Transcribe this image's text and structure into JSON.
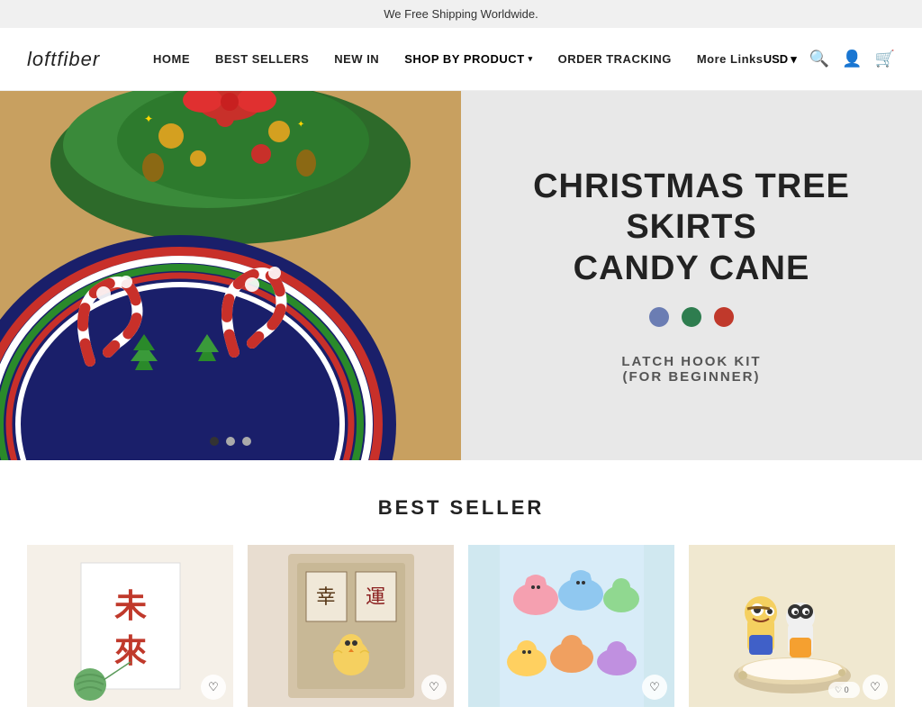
{
  "announcement": {
    "text": "We Free Shipping Worldwide."
  },
  "header": {
    "logo": "loftfiber",
    "nav": [
      {
        "label": "HOME",
        "has_dropdown": false
      },
      {
        "label": "BEST SELLERS",
        "has_dropdown": false
      },
      {
        "label": "NEW IN",
        "has_dropdown": false
      },
      {
        "label": "SHOP BY PRODUCT",
        "has_dropdown": true
      },
      {
        "label": "ORDER TRACKING",
        "has_dropdown": false
      },
      {
        "label": "More Links",
        "has_dropdown": false
      }
    ],
    "currency": "USD",
    "currency_arrow": "▾"
  },
  "hero": {
    "title_line1": "CHRISTMAS TREE SKIRTS",
    "title_line2": "CANDY CANE",
    "subtitle_line1": "LATCH HOOK KIT",
    "subtitle_line2": "(FOR BEGINNER)",
    "colors": [
      {
        "name": "blue",
        "hex": "#6b7db3"
      },
      {
        "name": "green",
        "hex": "#2e7d4f"
      },
      {
        "name": "red",
        "hex": "#c0392b"
      }
    ],
    "carousel_dots": [
      {
        "active": true
      },
      {
        "active": false
      },
      {
        "active": false
      }
    ]
  },
  "best_seller": {
    "section_title": "BEST SELLER",
    "products": [
      {
        "id": 1,
        "bg_color": "#f5f0e8",
        "emoji": "🎨",
        "alt": "Chinese calligraphy art product"
      },
      {
        "id": 2,
        "bg_color": "#e8ddd0",
        "emoji": "🐣",
        "alt": "Cute animal craft product"
      },
      {
        "id": 3,
        "bg_color": "#d0e8f5",
        "emoji": "🐾",
        "alt": "Animal slippers product"
      },
      {
        "id": 4,
        "bg_color": "#f0e8d0",
        "emoji": "🪆",
        "alt": "Cute dolls product"
      }
    ]
  },
  "icons": {
    "search": "🔍",
    "account": "👤",
    "cart": "🛒",
    "heart": "♡"
  }
}
